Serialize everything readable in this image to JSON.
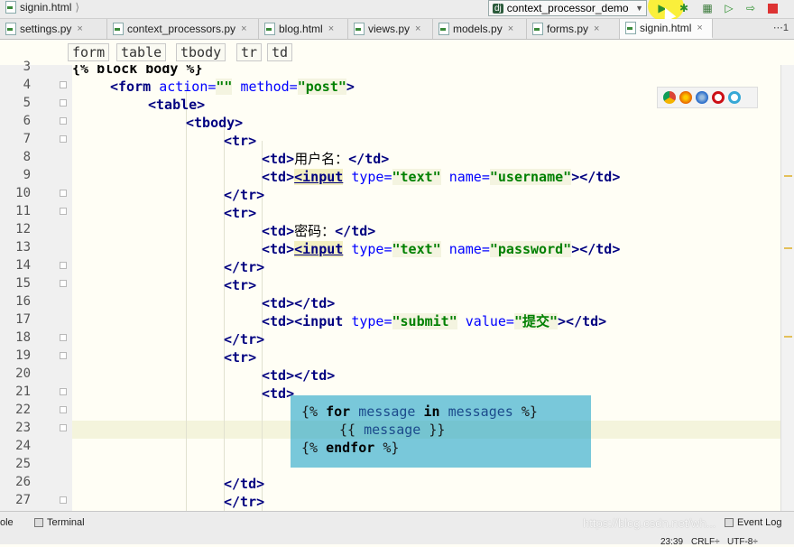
{
  "titlebar": {
    "breadcrumb_file": "signin.html",
    "run_config": "context_processor_demo",
    "run_config_prefix": "dj"
  },
  "tabs": [
    {
      "label": "settings.py"
    },
    {
      "label": "context_processors.py"
    },
    {
      "label": "blog.html"
    },
    {
      "label": "views.py"
    },
    {
      "label": "models.py"
    },
    {
      "label": "forms.py"
    },
    {
      "label": "signin.html",
      "active": true
    }
  ],
  "tab_menu": "⋯1",
  "tag_breadcrumbs": [
    "form",
    "table",
    "tbody",
    "tr",
    "td"
  ],
  "line_numbers": [
    "3",
    "4",
    "5",
    "6",
    "7",
    "8",
    "9",
    "10",
    "11",
    "12",
    "13",
    "14",
    "15",
    "16",
    "17",
    "18",
    "19",
    "20",
    "21",
    "22",
    "23",
    "24",
    "25",
    "26",
    "27"
  ],
  "code": {
    "l3": "{% block body %}",
    "l4_tag": "<form",
    "l4_attr1": "action=",
    "l4_val1": "\"\"",
    "l4_attr2": "method=",
    "l4_val2": "\"post\"",
    "l4_end": ">",
    "l5": "<table>",
    "l6": "<tbody>",
    "l7": "<tr>",
    "l8_open": "<td>",
    "l8_text": "用户名：",
    "l8_close": "</td>",
    "l9_td": "<td>",
    "l9_input": "<input",
    "l9_attr1": "type=",
    "l9_val1": "\"text\"",
    "l9_attr2": "name=",
    "l9_val2": "\"username\"",
    "l9_end": "></td>",
    "l10": "</tr>",
    "l11": "<tr>",
    "l12_open": "<td>",
    "l12_text": "密码：",
    "l12_close": "</td>",
    "l13_td": "<td>",
    "l13_input": "<input",
    "l13_attr1": "type=",
    "l13_val1": "\"text\"",
    "l13_attr2": "name=",
    "l13_val2": "\"password\"",
    "l13_end": "></td>",
    "l14": "</tr>",
    "l15": "<tr>",
    "l16": "<td></td>",
    "l17_td": "<td>",
    "l17_input": "<input",
    "l17_attr1": "type=",
    "l17_val1": "\"submit\"",
    "l17_attr2": "value=",
    "l17_val2": "\"提交\"",
    "l17_end": "></td>",
    "l18": "</tr>",
    "l19": "<tr>",
    "l20": "<td></td>",
    "l21": "<td>",
    "l22_open": "{%",
    "l22_for": "for",
    "l22_var": "message",
    "l22_in": "in",
    "l22_coll": "messages",
    "l22_close": "%}",
    "l23_open": "{{",
    "l23_var": "message",
    "l23_close": "}}",
    "l24_open": "{%",
    "l24_kw": "endfor",
    "l24_close": "%}",
    "l25": "",
    "l26": "</td>",
    "l27": "</tr>"
  },
  "statusbar": {
    "left_partial": "ole",
    "terminal": "Terminal",
    "event_log": "Event Log",
    "position": "23:39",
    "line_sep": "CRLF÷",
    "encoding": "UTF-8÷"
  },
  "watermark": "https://blog.csdn.net/wh..."
}
